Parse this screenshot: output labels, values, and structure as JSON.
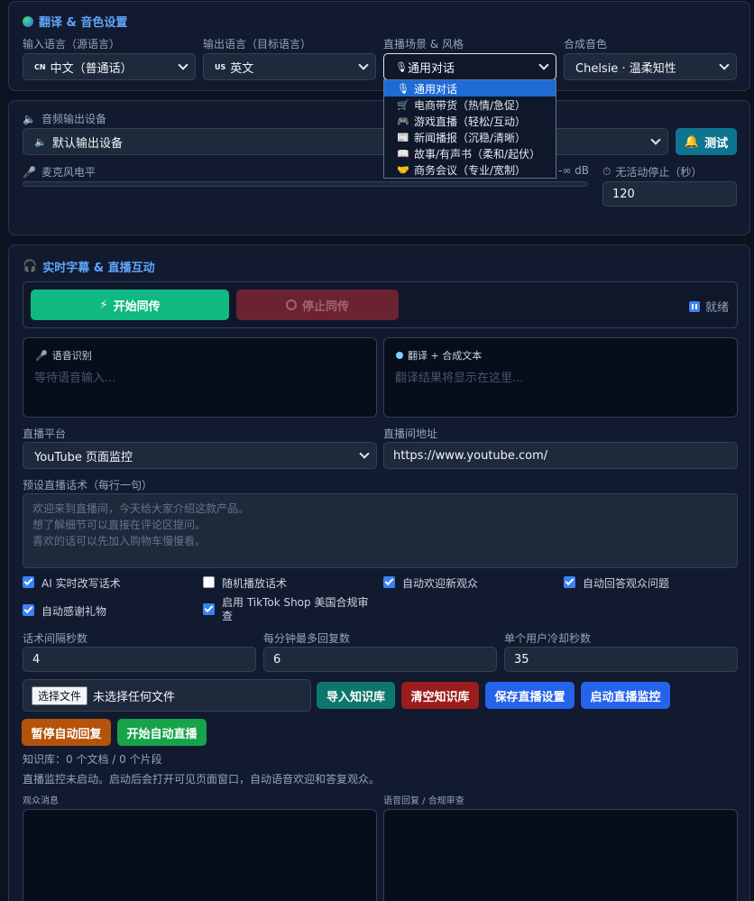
{
  "translate_section": {
    "title": "翻译 & 音色设置",
    "input_lang_label": "输入语言（源语言）",
    "input_lang_code": "CN",
    "input_lang_value": "中文（普通话）",
    "output_lang_label": "输出语言（目标语言）",
    "output_lang_code": "US",
    "output_lang_value": "英文",
    "scene_label": "直播场景 & 风格",
    "scene_value": "通用对话",
    "voice_label": "合成音色",
    "voice_value": "Chelsie · 温柔知性",
    "scene_options": [
      "通用对话",
      "电商带货（热情/急促）",
      "游戏直播（轻松/互动）",
      "新闻播报（沉稳/清晰）",
      "故事/有声书（柔和/起伏）",
      "商务会议（专业/宽制）"
    ]
  },
  "audio_section": {
    "title": "音频输出设备",
    "device_value": "默认输出设备",
    "test_button": "测试",
    "mic_label": "麦克风电平",
    "db_value": "-∞ dB",
    "idle_stop_label": "无活动停止（秒）",
    "idle_stop_value": "120",
    "mic_level": 0
  },
  "live_section": {
    "title": "实时字幕 & 直播互动",
    "start_button": "开始同传",
    "stop_button": "停止同传",
    "status": "就绪",
    "asr_title": "语音识别",
    "asr_placeholder": "等待语音输入...",
    "tts_title": "翻译 + 合成文本",
    "tts_placeholder": "翻译结果将显示在这里...",
    "platform_label": "直播平台",
    "platform_value": "YouTube 页面监控",
    "url_label": "直播间地址",
    "url_value": "https://www.youtube.com/",
    "script_label": "预设直播话术（每行一句）",
    "script_lines": [
      "欢迎来到直播间，今天给大家介绍这款产品。",
      "想了解细节可以直接在评论区提问。",
      "喜欢的话可以先加入购物车慢慢看。"
    ],
    "checkboxes": [
      {
        "label": "AI 实时改写话术",
        "checked": true
      },
      {
        "label": "随机播放话术",
        "checked": false
      },
      {
        "label": "自动欢迎新观众",
        "checked": true
      },
      {
        "label": "自动回答观众问题",
        "checked": true
      },
      {
        "label": "自动感谢礼物",
        "checked": true
      },
      {
        "label": "启用 TikTok Shop 美国合规审查",
        "checked": true
      }
    ],
    "interval_label": "话术间隔秒数",
    "interval_value": "4",
    "max_reply_label": "每分钟最多回复数",
    "max_reply_value": "6",
    "cooldown_label": "单个用户冷却秒数",
    "cooldown_value": "35",
    "file_button": "选择文件",
    "file_status": "未选择任何文件",
    "import_kb_button": "导入知识库",
    "clear_kb_button": "清空知识库",
    "save_button": "保存直播设置",
    "start_monitor_button": "启动直播监控",
    "pause_reply_button": "暂停自动回复",
    "start_auto_button": "开始自动直播",
    "kb_status": "知识库：0 个文档 / 0 个片段",
    "monitor_status": "直播监控未启动。启动后会打开可见页面窗口，自动语音欢迎和答复观众。",
    "viewer_msg_label": "观众消息",
    "voice_reply_label": "语音回复 / 合规审查"
  },
  "colors": {
    "accent": "#60a5fa",
    "start_green": "#10b981",
    "stop_red": "#6b2231",
    "teal": "#0e7490",
    "blue": "#2563eb",
    "dark_red": "#9b1c1c",
    "orange": "#b45309"
  }
}
